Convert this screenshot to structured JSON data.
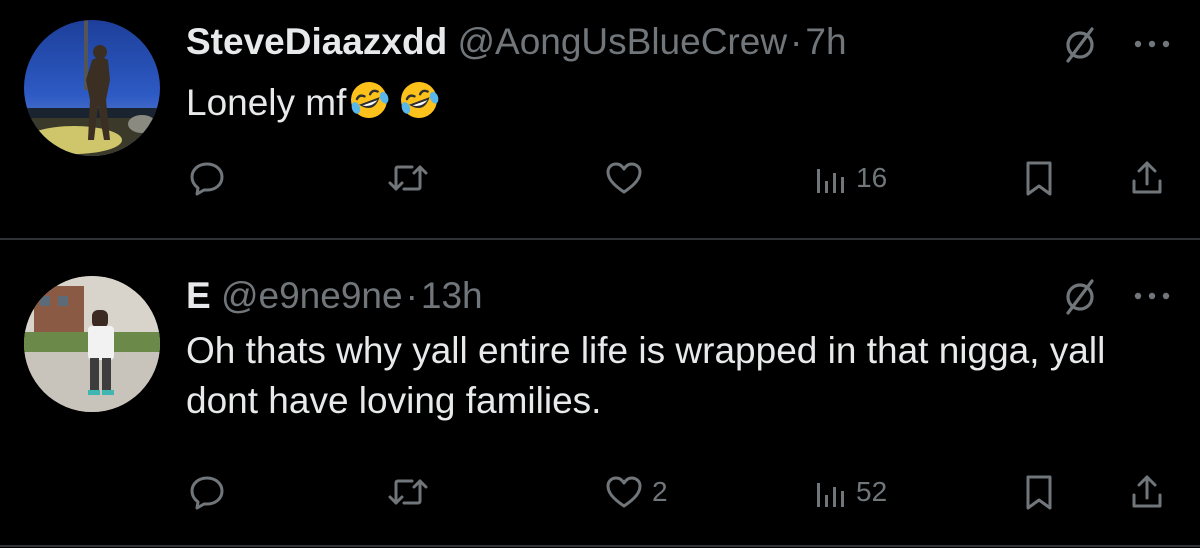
{
  "tweets": [
    {
      "display_name": "SteveDiaazxdd",
      "handle": "@AongUsBlueCrew",
      "separator": "·",
      "time": "7h",
      "text": "Lonely mf",
      "emojis": [
        "rolling-on-floor-laughing",
        "rolling-on-floor-laughing"
      ],
      "replies": "",
      "retweets": "",
      "likes": "",
      "views": "16"
    },
    {
      "display_name": "E",
      "handle": "@e9ne9ne",
      "separator": "·",
      "time": "13h",
      "text": "Oh thats why yall entire life is wrapped in that nigga, yall dont have loving families.",
      "emojis": [],
      "replies": "",
      "retweets": "",
      "likes": "2",
      "views": "52"
    }
  ],
  "icons": {
    "reply": "speech-bubble-icon",
    "retweet": "retweet-arrows-icon",
    "like": "heart-icon",
    "views": "bar-chart-icon",
    "bookmark": "bookmark-icon",
    "share": "share-upload-icon",
    "grok": "slashed-circle-icon",
    "more": "ellipsis-icon"
  },
  "colors": {
    "background": "#000000",
    "primary_text": "#e7e9ea",
    "secondary_text": "#71767b",
    "divider": "#2f3336"
  }
}
